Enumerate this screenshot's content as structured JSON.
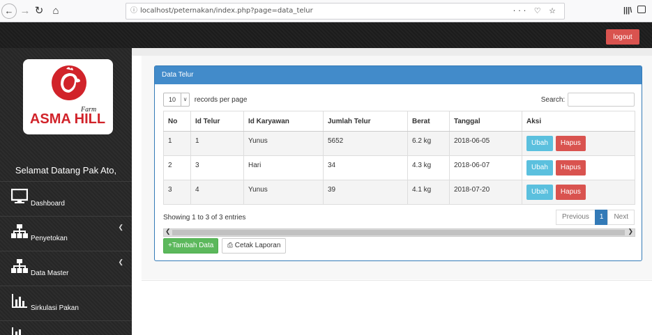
{
  "browser": {
    "url_info_icon": "info-icon",
    "url": "localhost/peternakan/index.php?page=data_telur",
    "page_actions": "··· ♡ ☆"
  },
  "topbar": {
    "logout_label": "logout"
  },
  "sidebar": {
    "logo": {
      "brand": "ASMA HILL",
      "tagline": "Farm"
    },
    "welcome": "Selamat Datang Pak Ato,",
    "items": [
      {
        "label": "Dashboard",
        "icon": "monitor-icon",
        "has_caret": false
      },
      {
        "label": "Penyetokan",
        "icon": "sitemap-icon",
        "has_caret": true
      },
      {
        "label": "Data Master",
        "icon": "sitemap-icon",
        "has_caret": true
      },
      {
        "label": "Sirkulasi Pakan",
        "icon": "bar-chart-icon",
        "has_caret": false
      }
    ]
  },
  "panel": {
    "title": "Data Telur",
    "length": {
      "value": "10",
      "label": "records per page"
    },
    "search": {
      "label": "Search:",
      "value": ""
    },
    "columns": [
      "No",
      "Id Telur",
      "Id Karyawan",
      "Jumlah Telur",
      "Berat",
      "Tanggal",
      "Aksi"
    ],
    "rows": [
      {
        "no": "1",
        "id_telur": "1",
        "id_karyawan": "Yunus",
        "jumlah": "5652",
        "berat": "6.2 kg",
        "tanggal": "2018-06-05"
      },
      {
        "no": "2",
        "id_telur": "3",
        "id_karyawan": "Hari",
        "jumlah": "34",
        "berat": "4.3 kg",
        "tanggal": "2018-06-07"
      },
      {
        "no": "3",
        "id_telur": "4",
        "id_karyawan": "Yunus",
        "jumlah": "39",
        "berat": "4.1 kg",
        "tanggal": "2018-07-20"
      }
    ],
    "row_actions": {
      "edit_label": "Ubah",
      "delete_label": "Hapus"
    },
    "info": "Showing 1 to 3 of 3 entries",
    "pagination": {
      "previous": "Previous",
      "current": "1",
      "next": "Next"
    },
    "buttons": {
      "add_label": "+Tambah Data",
      "print_label": "Cetak Laporan"
    }
  },
  "colors": {
    "panel_header": "#428bca",
    "logout": "#d9534f",
    "edit_button": "#5bc0de",
    "delete_button": "#d9534f",
    "add_button": "#5cb85c",
    "brand_red": "#d1232a"
  }
}
